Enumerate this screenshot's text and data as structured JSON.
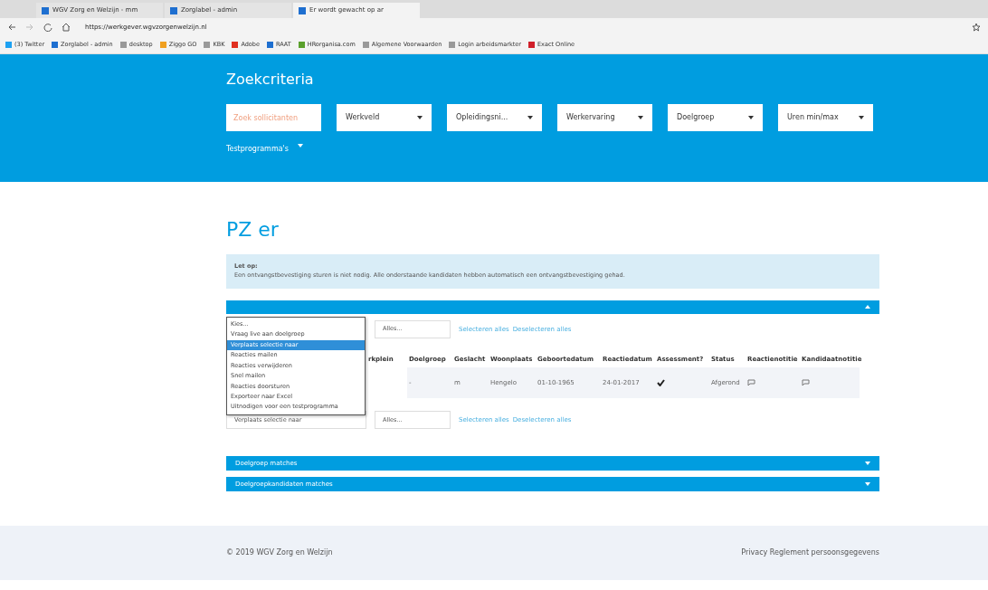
{
  "browser": {
    "tabs": [
      {
        "label": "WGV Zorg en Welzijn - mm",
        "selected": false
      },
      {
        "label": "Zorglabel - admin",
        "selected": false
      },
      {
        "label": "Er wordt gewacht op ar",
        "selected": true
      }
    ],
    "address": "https://werkgever.wgvzorgenwelzijn.nl",
    "bookmarks": [
      {
        "label": "(3) Twitter",
        "color": "#1da1f2"
      },
      {
        "label": "Zorglabel - admin",
        "color": "#1e6fd0"
      },
      {
        "label": "desktop",
        "color": "#999999"
      },
      {
        "label": "Ziggo GO",
        "color": "#f0a020"
      },
      {
        "label": "KBK",
        "color": "#999999"
      },
      {
        "label": "Adobe",
        "color": "#e03020"
      },
      {
        "label": "RAAT",
        "color": "#1e6fd0"
      },
      {
        "label": "HRorganisa.com",
        "color": "#5aa02c"
      },
      {
        "label": "Algemene Voorwaarden",
        "color": "#999999"
      },
      {
        "label": "Login arbeidsmarkter",
        "color": "#999999"
      },
      {
        "label": "Exact Online",
        "color": "#d0202a"
      }
    ]
  },
  "search": {
    "title": "Zoekcriteria",
    "placeholder": "Zoek sollicitanten",
    "filters": [
      "Werkveld",
      "Opleidingsni...",
      "Werkervaring",
      "Doelgroep",
      "Uren min/max"
    ],
    "testprogram": "Testprogramma's"
  },
  "heading": "PZ er",
  "alert": {
    "title": "Let op:",
    "text": "Een ontvangstbevestiging sturen is niet nodig. Alle onderstaande kandidaten hebben automatisch een ontvangstbevestiging gehad."
  },
  "menu": [
    {
      "label": "Kies...",
      "selected": false
    },
    {
      "label": "Vraag live aan doelgroep",
      "selected": false
    },
    {
      "label": "Verplaats selectie naar",
      "selected": true
    },
    {
      "label": "Reacties mailen",
      "selected": false
    },
    {
      "label": "Reacties verwijderen",
      "selected": false
    },
    {
      "label": "Snel mailen",
      "selected": false
    },
    {
      "label": "Reacties doorsturen",
      "selected": false
    },
    {
      "label": "Exporteer naar Excel",
      "selected": false
    },
    {
      "label": "Uitnodigen voor een testprogramma",
      "selected": false
    }
  ],
  "top_controls": {
    "filter": "Alles...",
    "select_all": "Selecteren alles",
    "deselect_all": "Deselecteren alles"
  },
  "table": {
    "columns": [
      "rkplein",
      "Doelgroep",
      "Geslacht",
      "Woonplaats",
      "Geboortedatum",
      "Reactiedatum",
      "Assessment?",
      "Status",
      "Reactienotitie",
      "Kandidaatnotitie"
    ],
    "rows": [
      {
        "cells": [
          "",
          "-",
          "m",
          "Hengelo",
          "01-10-1965",
          "24-01-2017"
        ],
        "assessment": true,
        "status": "Afgerond"
      }
    ]
  },
  "bottom_controls": {
    "action": "Verplaats selectie naar",
    "filter": "Alles...",
    "select_all": "Selecteren alles",
    "deselect_all": "Deselecteren alles"
  },
  "panels": [
    {
      "title": "Doelgroep matches",
      "expanded": false
    },
    {
      "title": "Doelgroepkandidaten matches",
      "expanded": false
    }
  ],
  "footer": {
    "copyright": "© 2019 WGV Zorg en Welzijn",
    "privacy": "Privacy Reglement persoonsgegevens"
  }
}
